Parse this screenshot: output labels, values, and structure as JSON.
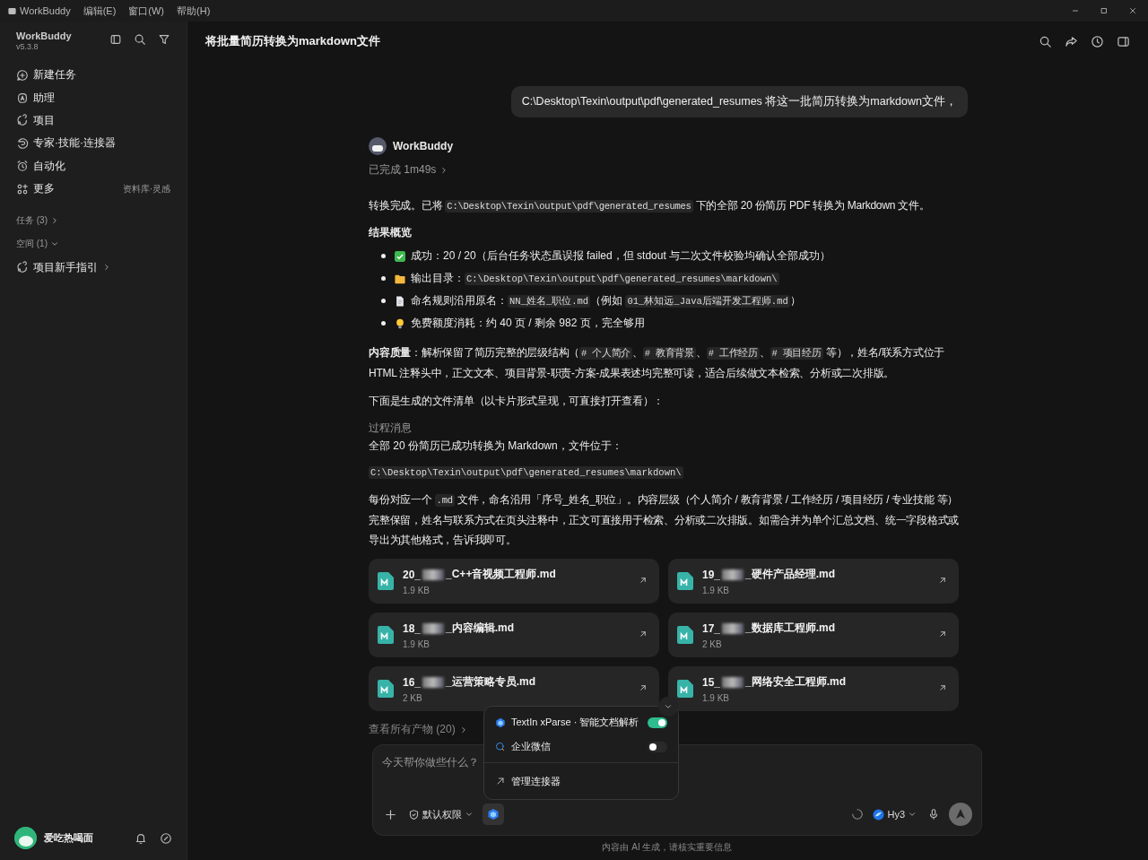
{
  "menu_bar": {
    "app_name": "WorkBuddy",
    "menus": [
      "编辑(E)",
      "窗口(W)",
      "帮助(H)"
    ]
  },
  "sidebar": {
    "app_name": "WorkBuddy",
    "version": "v5.3.8",
    "items": [
      {
        "label": "新建任务"
      },
      {
        "label": "助理"
      },
      {
        "label": "项目"
      },
      {
        "label": "专家·技能·连接器"
      },
      {
        "label": "自动化"
      },
      {
        "label": "更多",
        "hint": "资料库·灵感"
      }
    ],
    "sections": [
      {
        "label": "任务 (3)",
        "expanded": false
      },
      {
        "label": "空间 (1)",
        "expanded": true
      }
    ],
    "projects": [
      {
        "label": "项目新手指引"
      }
    ],
    "user": {
      "name": "爱吃热喝面"
    }
  },
  "chat": {
    "title": "将批量简历转换为markdown文件",
    "user_message": "C:\\Desktop\\Texin\\output\\pdf\\generated_resumes  将这一批简历转换为markdown文件，",
    "assistant": "WorkBuddy",
    "status": "已完成 1m49s",
    "blocks": [
      {
        "kind": "paragraph",
        "segments": [
          {
            "kind": "text",
            "text": "转换完成。已将 "
          },
          {
            "kind": "code",
            "text": "C:\\Desktop\\Texin\\output\\pdf\\generated_resumes"
          },
          {
            "kind": "text",
            "text": " 下的全部 20 份简历 PDF 转换为 Markdown 文件。"
          }
        ]
      },
      {
        "kind": "heading",
        "segments": [
          {
            "kind": "text",
            "text": "结果概览"
          }
        ]
      },
      {
        "kind": "bullets",
        "items": [
          [
            {
              "kind": "text",
              "text": "成功：20 / 20（后台任务状态虽误报 failed，但 stdout 与二次文件校验均确认全部成功）"
            }
          ],
          [
            {
              "kind": "text",
              "text": "输出目录："
            },
            {
              "kind": "code",
              "text": "C:\\Desktop\\Texin\\output\\pdf\\generated_resumes\\markdown\\"
            }
          ],
          [
            {
              "kind": "text",
              "text": "命名规则沿用原名："
            },
            {
              "kind": "code",
              "text": "NN_姓名_职位.md"
            },
            {
              "kind": "text",
              "text": "（例如 "
            },
            {
              "kind": "code",
              "text": "01_林知远_Java后端开发工程师.md"
            },
            {
              "kind": "text",
              "text": "）"
            }
          ],
          [
            {
              "kind": "text",
              "text": "免费额度消耗：约 40 页 / 剩余 982 页，完全够用"
            }
          ]
        ]
      },
      {
        "kind": "paragraph",
        "segments": [
          {
            "kind": "bold",
            "text": "内容质量"
          },
          {
            "kind": "text",
            "text": "：解析保留了简历完整的层级结构（"
          },
          {
            "kind": "code",
            "text": "# 个人简介"
          },
          {
            "kind": "text",
            "text": "、"
          },
          {
            "kind": "code",
            "text": "# 教育背景"
          },
          {
            "kind": "text",
            "text": "、"
          },
          {
            "kind": "code",
            "text": "# 工作经历"
          },
          {
            "kind": "text",
            "text": "、"
          },
          {
            "kind": "code",
            "text": "# 项目经历"
          },
          {
            "kind": "text",
            "text": " 等），姓名/联系方式位于 HTML 注释头中，正文文本、项目背景-职责-方案-成果表述均完整可读，适合后续做文本检索、分析或二次排版。"
          }
        ]
      },
      {
        "kind": "paragraph",
        "segments": [
          {
            "kind": "text",
            "text": "下面是生成的文件清单（以卡片形式呈现，可直接打开查看）："
          }
        ]
      },
      {
        "kind": "label",
        "segments": [
          {
            "kind": "text",
            "text": "过程消息"
          }
        ]
      },
      {
        "kind": "paragraph_tight",
        "segments": [
          {
            "kind": "text",
            "text": "全部 20 份简历已成功转换为 Markdown，文件位于："
          }
        ]
      },
      {
        "kind": "code_block",
        "segments": [
          {
            "kind": "code",
            "text": "C:\\Desktop\\Texin\\output\\pdf\\generated_resumes\\markdown\\"
          }
        ]
      },
      {
        "kind": "paragraph",
        "segments": [
          {
            "kind": "text",
            "text": "每份对应一个 "
          },
          {
            "kind": "code",
            "text": ".md"
          },
          {
            "kind": "text",
            "text": " 文件，命名沿用「序号_姓名_职位」。内容层级（个人简介 / 教育背景 / 工作经历 / 项目经历 / 专业技能 等）完整保留，姓名与联系方式在页头注释中，正文可直接用于检索、分析或二次排版。如需合并为单个汇总文档、统一字段格式或导出为其他格式，告诉我即可。"
          }
        ]
      }
    ],
    "files": [
      {
        "prefix": "20_",
        "suffix": "_C++音视频工程师.md",
        "size": "1.9 KB"
      },
      {
        "prefix": "19_",
        "suffix": "_硬件产品经理.md",
        "size": "1.9 KB"
      },
      {
        "prefix": "18_",
        "suffix": "_内容编辑.md",
        "size": "1.9 KB"
      },
      {
        "prefix": "17_",
        "suffix": "_数据库工程师.md",
        "size": "2 KB"
      },
      {
        "prefix": "16_",
        "suffix": "_运营策略专员.md",
        "size": "2 KB"
      },
      {
        "prefix": "15_",
        "suffix": "_网络安全工程师.md",
        "size": "1.9 KB"
      }
    ],
    "all_files": "查看所有产物 (20)"
  },
  "composer": {
    "placeholder": "今天帮你做些什么？",
    "permission": "默认权限",
    "model": "Hy3",
    "note": "内容由 AI 生成，请核实重要信息"
  },
  "connector_menu": {
    "items": [
      {
        "label": "TextIn xParse · 智能文档解析",
        "on": true
      },
      {
        "label": "企业微信",
        "on": false
      }
    ],
    "manage": "管理连接器"
  }
}
